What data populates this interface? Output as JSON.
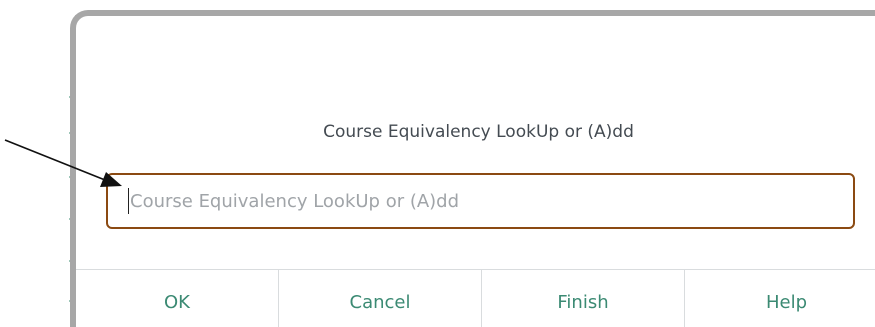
{
  "dialog": {
    "prompt": "Course Equivalency LookUp or (A)dd",
    "input": {
      "value": "",
      "placeholder": "Course Equivalency LookUp or (A)dd"
    },
    "buttons": [
      {
        "label": "OK"
      },
      {
        "label": "Cancel"
      },
      {
        "label": "Finish"
      },
      {
        "label": "Help"
      }
    ]
  },
  "colors": {
    "accent": "#3b8a73",
    "field_border": "#8b4a12",
    "dialog_border": "#a7a7a7"
  },
  "icons": [
    "pointer-arrow-icon"
  ]
}
